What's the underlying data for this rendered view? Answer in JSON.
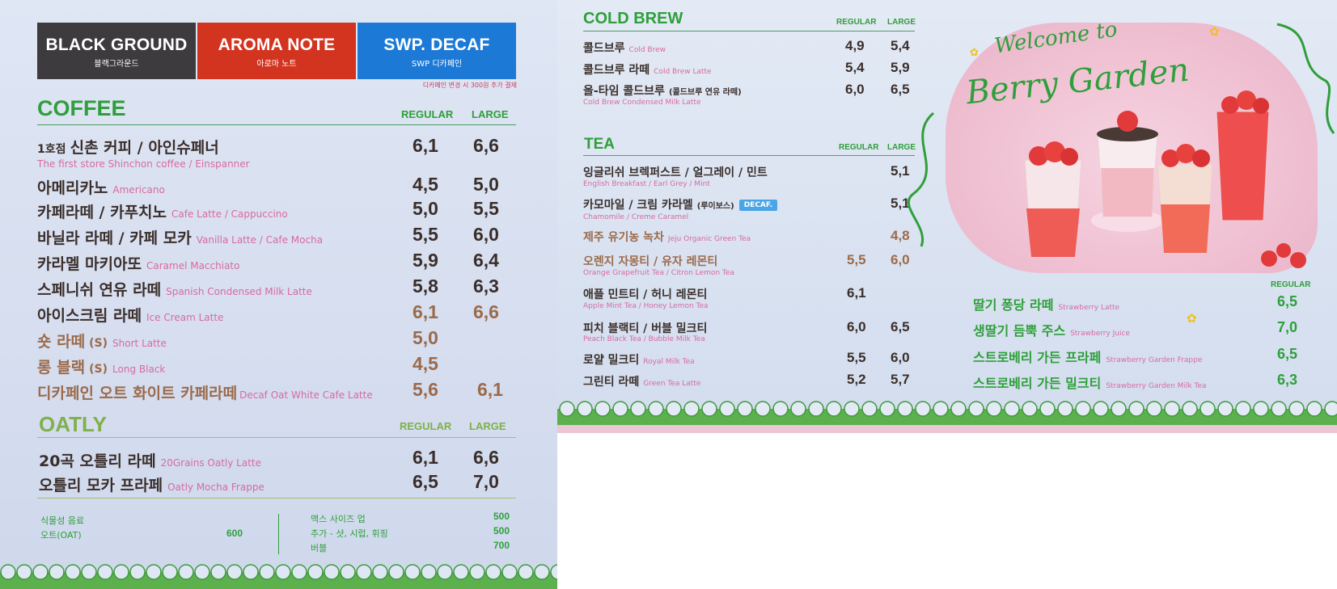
{
  "brands": [
    {
      "title": "BLACK GROUND",
      "sub": "블랙그라운드"
    },
    {
      "title": "AROMA NOTE",
      "sub": "아로마 노트"
    },
    {
      "title": "SWP. DECAF",
      "sub": "SWP 디카페인"
    }
  ],
  "decaf_note": "디카페인 변경 시 300원 추가 결제",
  "coffee": {
    "title": "COFFEE",
    "col_regular": "REGULAR",
    "col_large": "LARGE",
    "first_store_prefix": "1호점",
    "items": [
      {
        "kr": "신촌 커피 / 아인슈페너",
        "en": "The first store Shinchon coffee / Einspanner",
        "reg": "6,1",
        "lg": "6,6"
      },
      {
        "kr": "아메리카노",
        "en": "Americano",
        "reg": "4,5",
        "lg": "5,0"
      },
      {
        "kr": "카페라떼 / 카푸치노",
        "en": "Cafe Latte / Cappuccino",
        "reg": "5,0",
        "lg": "5,5"
      },
      {
        "kr": "바닐라 라떼 / 카페 모카",
        "en": "Vanilla Latte / Cafe Mocha",
        "reg": "5,5",
        "lg": "6,0"
      },
      {
        "kr": "카라멜 마키아또",
        "en": "Caramel Macchiato",
        "reg": "5,9",
        "lg": "6,4"
      },
      {
        "kr": "스페니쉬 연유 라떼",
        "en": "Spanish Condensed Milk Latte",
        "reg": "5,8",
        "lg": "6,3"
      },
      {
        "kr": "아이스크림 라떼",
        "en": "Ice Cream Latte",
        "reg": "6,1",
        "lg": "6,6"
      },
      {
        "kr": "숏 라떼",
        "tag": "(S)",
        "en": "Short Latte",
        "reg": "5,0",
        "lg": ""
      },
      {
        "kr": "롱 블랙",
        "tag": "(S)",
        "en": "Long Black",
        "reg": "4,5",
        "lg": ""
      },
      {
        "kr": "디카페인 오트 화이트 카페라떼",
        "en": "Decaf Oat White Cafe Latte",
        "reg": "5,6",
        "lg": "6,1"
      }
    ]
  },
  "oatly": {
    "title": "OATLY",
    "col_regular": "REGULAR",
    "col_large": "LARGE",
    "items": [
      {
        "kr": "20곡 오틀리 라떼",
        "en": "20Grains Oatly Latte",
        "reg": "6,1",
        "lg": "6,6"
      },
      {
        "kr": "오틀리 모카 프라페",
        "en": "Oatly Mocha Frappe",
        "reg": "6,5",
        "lg": "7,0"
      }
    ]
  },
  "footer": {
    "plant_label": "식물성 음료",
    "oat_label": "오트(OAT)",
    "oat_price": "600",
    "max_size": "맥스 사이즈 업",
    "max_size_price": "500",
    "extra": "추가 - 샷, 시럽, 휘핑",
    "extra_price": "500",
    "bubble": "버블",
    "bubble_price": "700"
  },
  "cold_brew": {
    "title": "COLD BREW",
    "col_regular": "REGULAR",
    "col_large": "LARGE",
    "items": [
      {
        "kr": "콜드브루",
        "en": "Cold Brew",
        "reg": "4,9",
        "lg": "5,4"
      },
      {
        "kr": "콜드브루 라떼",
        "en": "Cold Brew Latte",
        "reg": "5,4",
        "lg": "5,9"
      },
      {
        "kr": "올-타임 콜드브루",
        "small": "(콜드브루 연유 라떼)",
        "en": "Cold Brew Condensed Milk Latte",
        "reg": "6,0",
        "lg": "6,5"
      }
    ]
  },
  "tea": {
    "title": "TEA",
    "col_regular": "REGULAR",
    "col_large": "LARGE",
    "decaf_badge": "DECAF.",
    "items": [
      {
        "kr": "잉글리쉬 브렉퍼스트 / 얼그레이 / 민트",
        "en": "English Breakfast / Earl Grey / Mint",
        "reg": "",
        "lg": "5,1"
      },
      {
        "kr": "카모마일 / 크림 카라멜",
        "small": "(루이보스)",
        "en": "Chamomile / Creme Caramel",
        "reg": "",
        "lg": "5,1"
      },
      {
        "kr": "제주 유기농 녹차",
        "en": "Jeju Organic Green Tea",
        "reg": "",
        "lg": "4,8"
      },
      {
        "kr": "오렌지 자몽티 / 유자 레몬티",
        "en": "Orange Grapefruit Tea / Citron Lemon Tea",
        "reg": "5,5",
        "lg": "6,0"
      },
      {
        "kr": "애플 민트티 / 허니 레몬티",
        "en": "Apple Mint Tea / Honey Lemon Tea",
        "reg": "6,1",
        "lg": ""
      },
      {
        "kr": "피치 블랙티 / 버블 밀크티",
        "en": "Peach Black Tea / Bubble Milk Tea",
        "reg": "6,0",
        "lg": "6,5"
      },
      {
        "kr": "로얄 밀크티",
        "en": "Royal Milk Tea",
        "reg": "5,5",
        "lg": "6,0"
      },
      {
        "kr": "그린티 라떼",
        "en": "Green Tea Latte",
        "reg": "5,2",
        "lg": "5,7"
      }
    ]
  },
  "berry": {
    "welcome_line1": "Welcome to",
    "welcome_line2": "Berry Garden",
    "col_regular": "REGULAR",
    "items": [
      {
        "kr": "딸기 퐁당 라떼",
        "en": "Strawberry Latte",
        "reg": "6,5"
      },
      {
        "kr": "생딸기 듬뿍 주스",
        "en": "Strawberry Juice",
        "reg": "7,0"
      },
      {
        "kr": "스트로베리 가든 프라페",
        "en": "Strawberry Garden Frappe",
        "reg": "6,5"
      },
      {
        "kr": "스트로베리 가든 밀크티",
        "en": "Strawberry Garden Milk Tea",
        "reg": "6,3"
      }
    ]
  },
  "colors": {
    "green": "#2e9f3a",
    "pink": "#d96aa0",
    "brown": "#9b6a4a",
    "red": "#d3341f",
    "blue": "#1c79d6",
    "dark": "#3d3b3e"
  }
}
